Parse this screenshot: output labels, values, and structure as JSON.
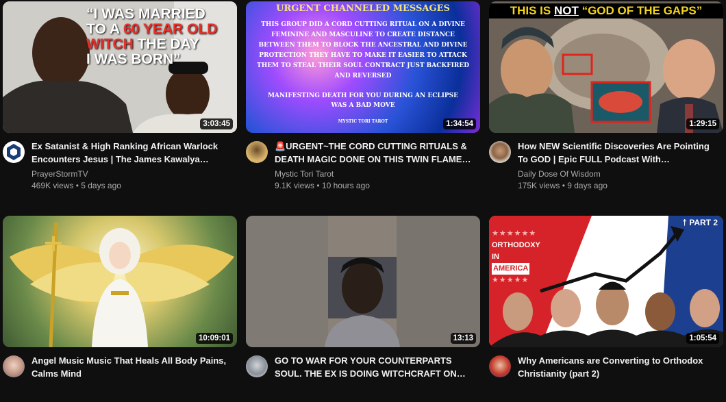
{
  "videos": [
    {
      "title": "Ex Satanist & High Ranking African Warlock Encounters Jesus | The James Kawalya…",
      "channel": "PrayerStormTV",
      "stats": "469K views • 5 days ago",
      "duration": "3:03:45",
      "thumb_text": [
        "“I WAS MARRIED",
        "TO A ",
        "60 YEAR OLD",
        "WITCH",
        " THE DAY",
        "I WAS BORN”"
      ]
    },
    {
      "title": "🚨URGENT~THE CORD CUTTING RITUALS & DEATH MAGIC DONE ON THIS TWIN FLAME…",
      "channel": "Mystic Tori Tarot",
      "stats": "9.1K views • 10 hours ago",
      "duration": "1:34:54",
      "thumb_text": {
        "heading": "URGENT CHANNELED MESSAGES",
        "body": "THIS GROUP DID A CORD CUTTING RITUAL ON A DIVINE FEMININE AND MASCULINE TO CREATE DISTANCE BETWEEN THEM TO BLOCK THE ANCESTRAL AND DIVINE PROTECTION THEY HAVE TO MAKE IT EASIER TO ATTACK THEM TO STEAL THEIR SOUL CONTRACT JUST BACKFIRED AND REVERSED",
        "footer": "MANIFESTING DEATH FOR YOU DURING AN ECLIPSE WAS A BAD MOVE",
        "credit": "MYSTIC TORI TAROT"
      }
    },
    {
      "title": "How NEW Scientific Discoveries Are Pointing To GOD | Epic FULL Podcast With…",
      "channel": "Daily Dose Of Wisdom",
      "stats": "175K views • 9 days ago",
      "duration": "1:29:15",
      "thumb_text": [
        "THIS IS ",
        "NOT",
        " “GOD OF THE GAPS”"
      ]
    },
    {
      "title": "Angel Music Music That Heals All Body Pains, Calms Mind",
      "channel": "",
      "stats": "",
      "duration": "10:09:01"
    },
    {
      "title": "GO TO WAR FOR YOUR COUNTERPARTS SOUL. THE EX IS DOING WITCHCRAFT ON…",
      "channel": "",
      "stats": "",
      "duration": "13:13"
    },
    {
      "title": "Why Americans are Converting to Orthodox Christianity (part 2)",
      "channel": "",
      "stats": "",
      "duration": "1:05:54",
      "thumb_text": {
        "part": "† PART 2",
        "label": [
          "ORTHODOXY",
          "IN",
          "AMERICA"
        ]
      }
    }
  ]
}
